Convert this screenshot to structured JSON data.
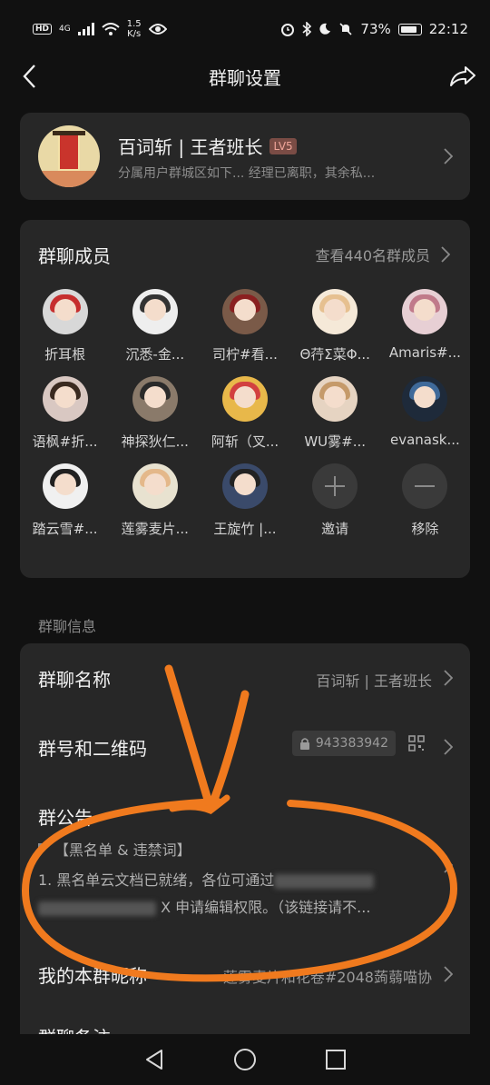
{
  "status": {
    "hd": "HD",
    "signal": "4G",
    "netspeed_value": "1.5",
    "netspeed_unit": "K/s",
    "battery": "73%",
    "time": "22:12"
  },
  "nav": {
    "title": "群聊设置"
  },
  "group": {
    "name": "百词斩 | 王者班长",
    "level": "LV5",
    "description": "分属用户群城区如下... 经理已离职，其余私..."
  },
  "members": {
    "title": "群聊成员",
    "view_all": "查看440名群成员",
    "list": [
      {
        "name": "折耳根",
        "bg": "#d8d8d8",
        "hair": "#c62e2e"
      },
      {
        "name": "沉悉-金...",
        "bg": "#eeeeee",
        "hair": "#333333"
      },
      {
        "name": "司柠#看...",
        "bg": "#7a5a48",
        "hair": "#8a2020"
      },
      {
        "name": "Θ荇Σ菜Φ...",
        "bg": "#f5e9d8",
        "hair": "#e6c090"
      },
      {
        "name": "Amaris#...",
        "bg": "#e7cfd4",
        "hair": "#c07a8a"
      },
      {
        "name": "语枫#折...",
        "bg": "#d9c8c2",
        "hair": "#3a2a20"
      },
      {
        "name": "神探狄仁...",
        "bg": "#8a7a6a",
        "hair": "#2a2a2a"
      },
      {
        "name": "阿斩（叉...",
        "bg": "#e8b84a",
        "hair": "#d24040"
      },
      {
        "name": "WU雾#...",
        "bg": "#e6d4c2",
        "hair": "#c59a6a"
      },
      {
        "name": "evanask...",
        "bg": "#1e2a3a",
        "hair": "#3f6a9a"
      },
      {
        "name": "踏云雪#...",
        "bg": "#f0f0f0",
        "hair": "#202020"
      },
      {
        "name": "莲雾麦片...",
        "bg": "#e8e2d0",
        "hair": "#e4b88a"
      },
      {
        "name": "王旋竹 |...",
        "bg": "#3a4a6a",
        "hair": "#222222"
      }
    ],
    "invite_label": "邀请",
    "remove_label": "移除"
  },
  "info": {
    "section_label": "群聊信息",
    "name_label": "群聊名称",
    "name_value": "百词斩 | 王者班长",
    "number_label": "群号和二维码",
    "number_value": "943383942",
    "announcement_label": "群公告",
    "announcement_tag": "【黑名单 & 违禁词】",
    "announcement_line1": "1. 黑名单云文档已就绪，各位可通过",
    "announcement_line2": "X 申请编辑权限。（该链接请不...",
    "nickname_label": "我的本群昵称",
    "nickname_value": "莲雾麦片和花卷#2048蒟蒻喵协",
    "next_label": "群聊备注"
  },
  "colors": {
    "background": "#111111",
    "card": "#272727",
    "annotation_orange": "#f07a1e"
  }
}
